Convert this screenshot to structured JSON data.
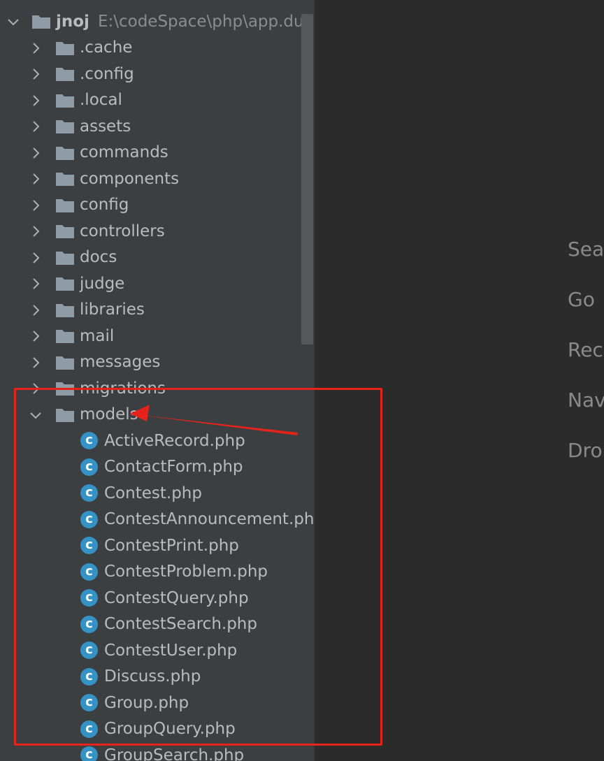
{
  "project_tree": {
    "root": {
      "name": "jnoj",
      "path": "E:\\codeSpace\\php\\app.duil",
      "expanded": true,
      "icon": "folder-icon"
    },
    "folders": [
      {
        "label": ".cache",
        "expanded": false
      },
      {
        "label": ".config",
        "expanded": false
      },
      {
        "label": ".local",
        "expanded": false
      },
      {
        "label": "assets",
        "expanded": false
      },
      {
        "label": "commands",
        "expanded": false
      },
      {
        "label": "components",
        "expanded": false
      },
      {
        "label": "config",
        "expanded": false
      },
      {
        "label": "controllers",
        "expanded": false
      },
      {
        "label": "docs",
        "expanded": false
      },
      {
        "label": "judge",
        "expanded": false
      },
      {
        "label": "libraries",
        "expanded": false
      },
      {
        "label": "mail",
        "expanded": false
      },
      {
        "label": "messages",
        "expanded": false
      },
      {
        "label": "migrations",
        "expanded": false
      }
    ],
    "expanded_folder": {
      "label": "models",
      "expanded": true,
      "files": [
        "ActiveRecord.php",
        "ContactForm.php",
        "Contest.php",
        "ContestAnnouncement.ph",
        "ContestPrint.php",
        "ContestProblem.php",
        "ContestQuery.php",
        "ContestSearch.php",
        "ContestUser.php",
        "Discuss.php",
        "Group.php",
        "GroupQuery.php",
        "GroupSearch.php"
      ],
      "file_icon_glyph": "c"
    }
  },
  "editor_hints": [
    "Sea",
    "Go ",
    "Rec",
    "Nav",
    "Dro"
  ],
  "colors": {
    "tree_background": "#3c3f41",
    "editor_background": "#2b2b2b",
    "text": "#bbbbbb",
    "folder_icon": "#8f9ba6",
    "class_icon": "#3592c4",
    "annotation": "#e5231b"
  }
}
